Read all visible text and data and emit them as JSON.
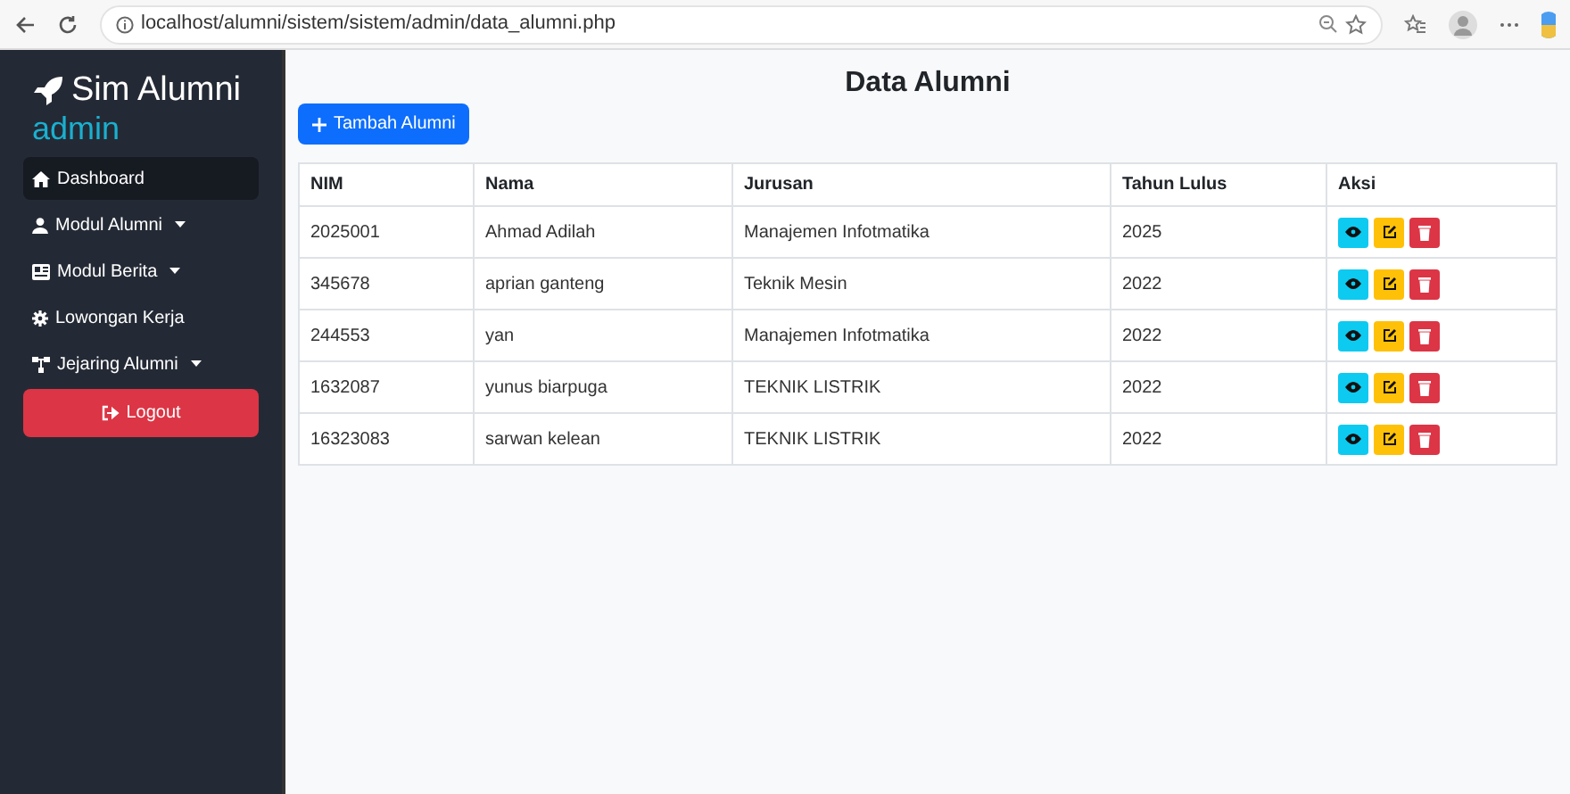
{
  "browser": {
    "url": "localhost/alumni/sistem/sistem/admin/data_alumni.php"
  },
  "sidebar": {
    "brand": "Sim Alumni",
    "role": "admin",
    "items": [
      {
        "label": "Dashboard",
        "selected": true,
        "dropdown": false
      },
      {
        "label": "Modul Alumni",
        "selected": false,
        "dropdown": true
      },
      {
        "label": "Modul Berita",
        "selected": false,
        "dropdown": true
      },
      {
        "label": "Lowongan Kerja",
        "selected": false,
        "dropdown": false
      },
      {
        "label": "Jejaring Alumni",
        "selected": false,
        "dropdown": true
      }
    ],
    "logout": "Logout"
  },
  "page": {
    "title": "Data Alumni",
    "add_button": "Tambah Alumni"
  },
  "table": {
    "columns": [
      "NIM",
      "Nama",
      "Jurusan",
      "Tahun Lulus",
      "Aksi"
    ],
    "rows": [
      [
        "2025001",
        "Ahmad Adilah",
        "Manajemen Infotmatika",
        "2025"
      ],
      [
        "345678",
        "aprian ganteng",
        "Teknik Mesin",
        "2022"
      ],
      [
        "244553",
        "yan",
        "Manajemen Infotmatika",
        "2022"
      ],
      [
        "1632087",
        "yunus biarpuga",
        "TEKNIK LISTRIK",
        "2022"
      ],
      [
        "16323083",
        "sarwan kelean",
        "TEKNIK LISTRIK",
        "2022"
      ]
    ]
  }
}
